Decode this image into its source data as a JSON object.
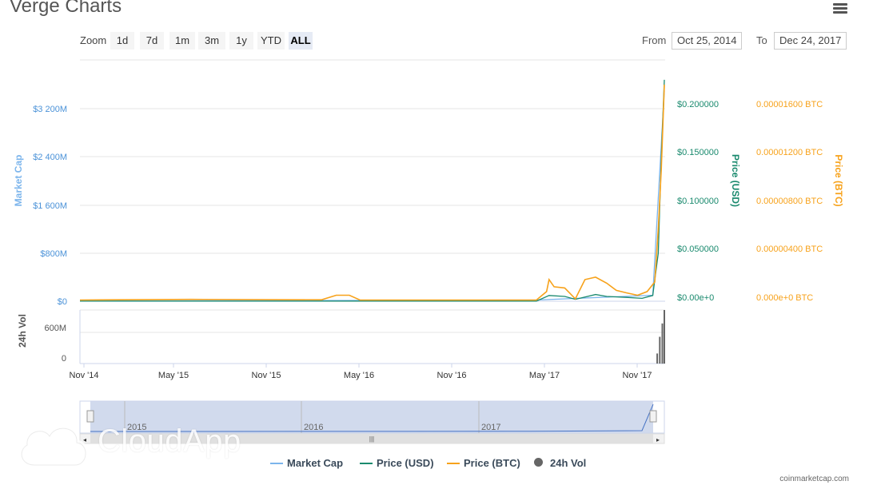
{
  "page": {
    "title": "Verge Charts",
    "credit": "coinmarketcap.com"
  },
  "zoom": {
    "label": "Zoom",
    "buttons": [
      "1d",
      "7d",
      "1m",
      "3m",
      "1y",
      "YTD",
      "ALL"
    ],
    "active": "ALL"
  },
  "range": {
    "from_label": "From",
    "from": "Oct 25, 2014",
    "to_label": "To",
    "to": "Dec 24, 2017"
  },
  "legend": [
    {
      "name": "Market Cap",
      "color": "#7cb5ec"
    },
    {
      "name": "Price (USD)",
      "color": "#1a8a6e"
    },
    {
      "name": "Price (BTC)",
      "color": "#f7a21b"
    },
    {
      "name": "24h Vol",
      "color": "#666666"
    }
  ],
  "watermark": "CloudApp",
  "chart_data": {
    "type": "line",
    "x_ticks": [
      "Nov '14",
      "May '15",
      "Nov '15",
      "May '16",
      "Nov '16",
      "May '17",
      "Nov '17"
    ],
    "axes": {
      "market_cap": {
        "label": "Market Cap",
        "ticks": [
          "$0",
          "$800M",
          "$1 600M",
          "$2 400M",
          "$3 200M"
        ],
        "range": [
          0,
          3200
        ],
        "unit": "M USD"
      },
      "price_usd": {
        "label": "Price (USD)",
        "ticks": [
          "$0.00e+0",
          "$0.050000",
          "$0.100000",
          "$0.150000",
          "$0.200000"
        ],
        "range": [
          0,
          0.2
        ]
      },
      "price_btc": {
        "label": "Price (BTC)",
        "ticks": [
          "0.000e+0 BTC",
          "0.00000400 BTC",
          "0.00000800 BTC",
          "0.00001200 BTC",
          "0.00001600 BTC"
        ],
        "range": [
          0,
          1.6e-05
        ]
      },
      "volume": {
        "label": "24h Vol",
        "ticks": [
          "0",
          "600M"
        ]
      }
    },
    "series": [
      {
        "name": "Price (BTC)",
        "color": "#f7a21b",
        "x": [
          "2014-10-25",
          "2015-06-01",
          "2016-02-15",
          "2016-03-15",
          "2016-03-25",
          "2016-04-10",
          "2016-05-01",
          "2017-04-15",
          "2017-05-05",
          "2017-05-10",
          "2017-05-20",
          "2017-06-10",
          "2017-07-01",
          "2017-07-20",
          "2017-08-10",
          "2017-09-01",
          "2017-09-20",
          "2017-10-10",
          "2017-11-01",
          "2017-11-20",
          "2017-12-05",
          "2017-12-12",
          "2017-12-18",
          "2017-12-24"
        ],
        "values": [
          1e-07,
          1.5e-07,
          1.2e-07,
          5e-07,
          5e-07,
          5e-07,
          1e-07,
          1e-07,
          8e-07,
          1.8e-06,
          1.2e-06,
          1.1e-06,
          2e-07,
          1.8e-06,
          2e-06,
          1.5e-06,
          9e-07,
          7e-07,
          5e-07,
          8e-07,
          1.6e-06,
          6e-06,
          1.1e-05,
          1.8e-05
        ]
      },
      {
        "name": "Price (USD)",
        "color": "#1a8a6e",
        "x": [
          "2014-10-25",
          "2017-04-15",
          "2017-05-10",
          "2017-06-10",
          "2017-07-01",
          "2017-08-10",
          "2017-09-01",
          "2017-10-10",
          "2017-11-10",
          "2017-12-01",
          "2017-12-12",
          "2017-12-18",
          "2017-12-24"
        ],
        "values": [
          0.0001,
          0.0002,
          0.006,
          0.005,
          0.002,
          0.007,
          0.005,
          0.004,
          0.003,
          0.006,
          0.05,
          0.15,
          0.23
        ]
      },
      {
        "name": "Market Cap",
        "color": "#7cb5ec",
        "x": [
          "2014-10-25",
          "2017-04-15",
          "2017-12-01",
          "2017-12-24"
        ],
        "values": [
          2,
          20,
          100,
          3500
        ]
      },
      {
        "name": "24h Vol",
        "color": "#666666",
        "x": [
          "2017-12-10",
          "2017-12-15",
          "2017-12-20",
          "2017-12-24"
        ],
        "values": [
          150,
          400,
          600,
          800
        ]
      }
    ],
    "navigator_labels": [
      "2015",
      "2016",
      "2017"
    ],
    "grid": true
  }
}
